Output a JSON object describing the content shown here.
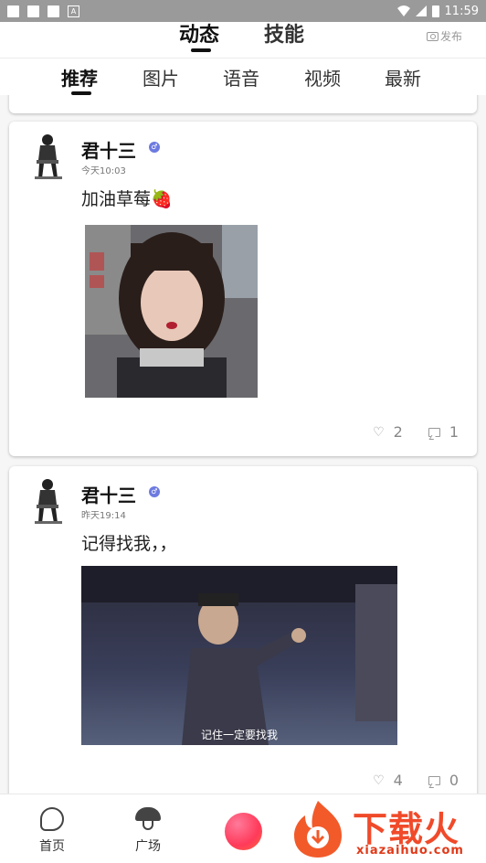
{
  "status_bar": {
    "time": "11:59"
  },
  "top_tabs": [
    {
      "label": "动态",
      "active": true
    },
    {
      "label": "技能",
      "active": false
    }
  ],
  "publish_label": "发布",
  "sub_tabs": [
    {
      "label": "推荐",
      "active": true
    },
    {
      "label": "图片",
      "active": false
    },
    {
      "label": "语音",
      "active": false
    },
    {
      "label": "视频",
      "active": false
    },
    {
      "label": "最新",
      "active": false
    }
  ],
  "posts": [
    {
      "username": "君十三",
      "gender_symbol": "♂",
      "time": "今天10:03",
      "text": "加油草莓🍓",
      "media_type": "image",
      "likes": "2",
      "comments": "1"
    },
    {
      "username": "君十三",
      "gender_symbol": "♂",
      "time": "昨天19:14",
      "text": "记得找我，，",
      "media_type": "video",
      "video_caption": "记住一定要找我",
      "likes": "4",
      "comments": "0"
    }
  ],
  "bottom_nav": [
    {
      "label": "首页",
      "icon": "home-icon"
    },
    {
      "label": "广场",
      "icon": "square-icon"
    }
  ],
  "watermark": {
    "title": "下载火",
    "url": "xiazaihuo.com"
  },
  "colors": {
    "accent_publish": "#ff4466",
    "gender_badge": "#6d7ae0",
    "watermark": "#f04a2a"
  }
}
